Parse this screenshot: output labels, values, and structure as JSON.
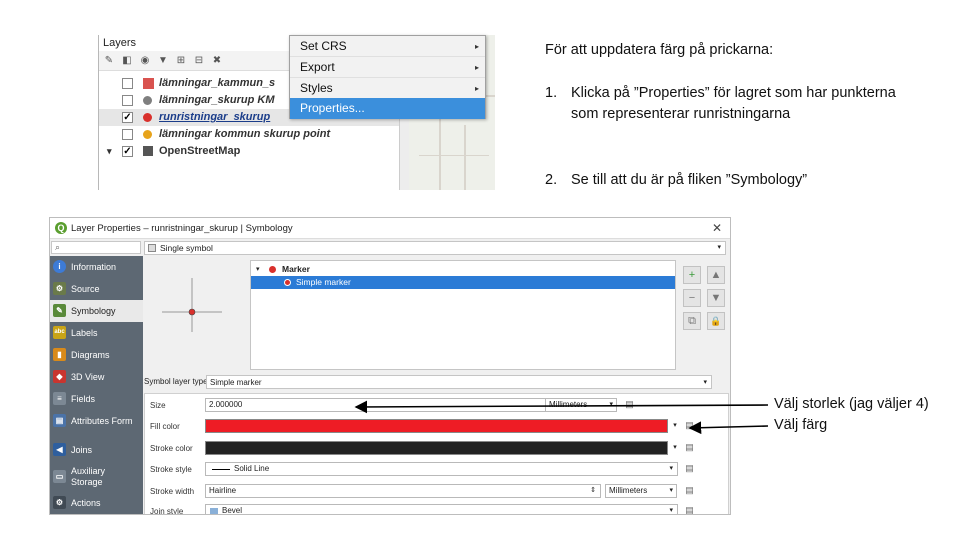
{
  "layers_panel": {
    "title": "Layers",
    "toolbar_icons": [
      "style-icon",
      "filter-legend-icon",
      "add-group-icon",
      "filter-icon",
      "expand-icon",
      "collapse-icon",
      "remove-layer-icon"
    ],
    "layers": [
      {
        "name": "lämningar_kammun_s",
        "checked": false,
        "symbol": "square",
        "color": "#d9534f"
      },
      {
        "name": "lämningar_skurup KM",
        "checked": false,
        "symbol": "circle",
        "color": "#7f7f7f"
      },
      {
        "name": "runristningar_skurup",
        "checked": true,
        "symbol": "circle",
        "color": "#d9302c",
        "selected": true
      },
      {
        "name": "lämningar kommun skurup point",
        "checked": false,
        "symbol": "circle",
        "color": "#e7a31b"
      },
      {
        "name": "OpenStreetMap",
        "checked": true,
        "symbol": "raster",
        "color": "#555555"
      }
    ],
    "check_mark": "✓",
    "expand_arrow": "▾"
  },
  "context_menu": {
    "items": [
      {
        "label": "Set CRS",
        "has_submenu": true
      },
      {
        "label": "Export",
        "has_submenu": true
      },
      {
        "label": "Styles",
        "has_submenu": true
      },
      {
        "label": "Properties...",
        "has_submenu": false,
        "highlighted": true
      }
    ],
    "submenu_arrow": "▸"
  },
  "instructions": {
    "heading": "För att uppdatera färg på prickarna:",
    "steps": [
      {
        "num": "1.",
        "text": "Klicka på ”Properties” för lagret som har punkterna som representerar runristningarna"
      },
      {
        "num": "2.",
        "text": "Se till att du är på fliken ”Symbology”"
      }
    ]
  },
  "dialog": {
    "title": "Layer Properties – runristningar_skurup | Symbology",
    "logo": "Q",
    "close": "✕",
    "search_icon": "⌕",
    "symbol_type": "Single symbol",
    "sidebar": [
      {
        "label": "Information",
        "icon": "info-icon",
        "color": "#3d7bd6",
        "glyph": "i"
      },
      {
        "label": "Source",
        "icon": "source-icon",
        "color": "#6a7a4a",
        "glyph": "⚙"
      },
      {
        "label": "Symbology",
        "icon": "symbology-icon",
        "color": "#5a8a3a",
        "glyph": "✎",
        "selected": true
      },
      {
        "label": "Labels",
        "icon": "labels-icon",
        "color": "#c9a417",
        "glyph": "abc"
      },
      {
        "label": "Diagrams",
        "icon": "diagrams-icon",
        "color": "#d88a1a",
        "glyph": "▮"
      },
      {
        "label": "3D View",
        "icon": "3d-view-icon",
        "color": "#c9352f",
        "glyph": "◆"
      },
      {
        "label": "Fields",
        "icon": "fields-icon",
        "color": "#7c8894",
        "glyph": "≡"
      },
      {
        "label": "Attributes Form",
        "icon": "attributes-form-icon",
        "color": "#4b73a8",
        "glyph": "▤"
      },
      {
        "label": "Joins",
        "icon": "joins-icon",
        "color": "#2f5f9e",
        "glyph": "◀"
      },
      {
        "label": "Auxiliary Storage",
        "icon": "auxiliary-storage-icon",
        "color": "#7c8894",
        "glyph": "▭",
        "two_line": true
      },
      {
        "label": "Actions",
        "icon": "actions-icon",
        "color": "#404a54",
        "glyph": "⚙"
      }
    ],
    "tree": [
      {
        "label": "Marker",
        "level": 0,
        "selected": false
      },
      {
        "label": "Simple marker",
        "level": 1,
        "selected": true
      }
    ],
    "tree_buttons": [
      "+",
      "▲",
      "−",
      "▼",
      "⧉",
      "🔒"
    ],
    "symbol_layer_type_label": "Symbol layer type",
    "symbol_layer_type_value": "Simple marker",
    "properties": [
      {
        "label": "Size",
        "value": "2.000000",
        "unit": "Millimeters",
        "kind": "spin"
      },
      {
        "label": "Fill color",
        "value": "",
        "kind": "color",
        "color": "#ee1c25"
      },
      {
        "label": "Stroke color",
        "value": "",
        "kind": "color",
        "color": "#222222"
      },
      {
        "label": "Stroke style",
        "value": "Solid Line",
        "kind": "linestyle"
      },
      {
        "label": "Stroke width",
        "value": "Hairline",
        "unit": "Millimeters",
        "kind": "spin"
      },
      {
        "label": "Join style",
        "value": "Bevel",
        "kind": "select"
      }
    ],
    "dropdown_arrow": "▾"
  },
  "annotations": {
    "size_note": "Välj storlek (jag väljer 4)",
    "color_note": "Välj färg"
  }
}
